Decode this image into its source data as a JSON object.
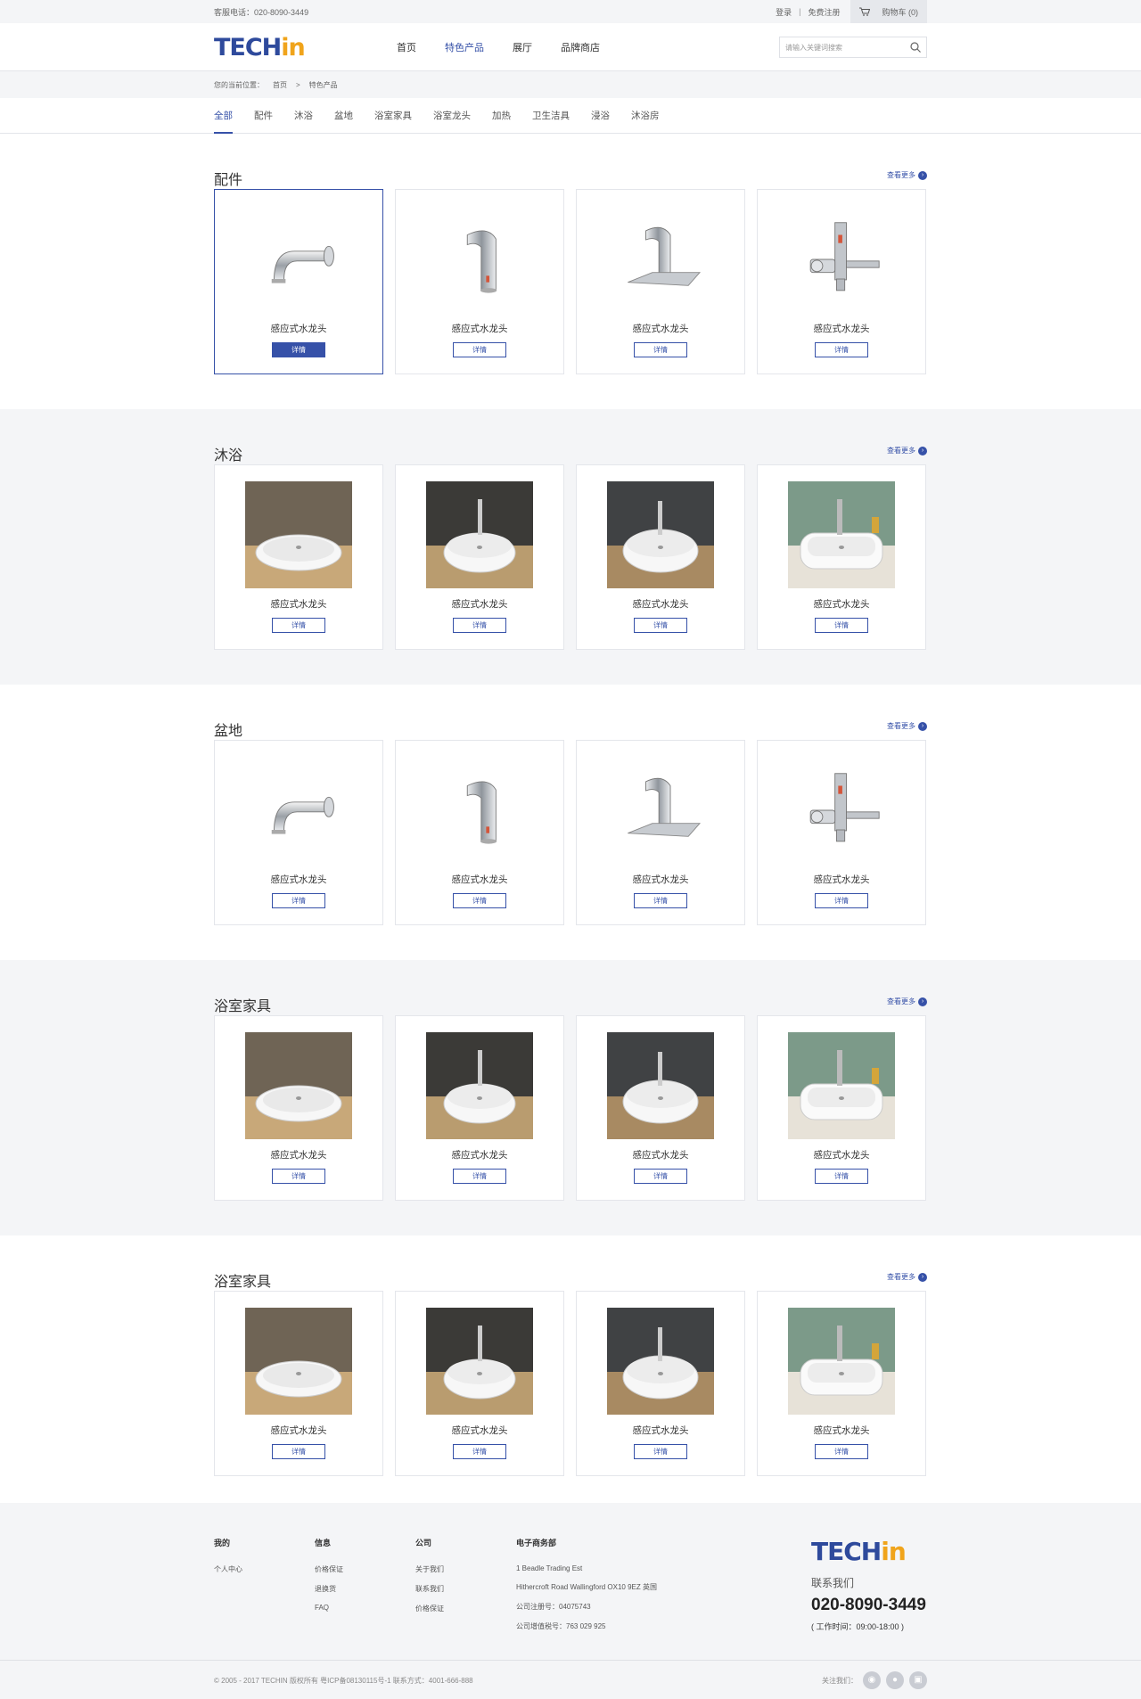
{
  "topbar": {
    "phone_label": "客服电话：",
    "phone": "020-8090-3449",
    "login": "登录",
    "sep": "|",
    "register": "免费注册",
    "cart": "购物车 (0)"
  },
  "header": {
    "logo_a": "TECH",
    "logo_b": "in",
    "nav": [
      "首页",
      "特色产品",
      "展厅",
      "品牌商店"
    ],
    "nav_active": 1,
    "search_placeholder": "请输入关键词搜索"
  },
  "breadcrumb": {
    "prefix": "您的当前位置：",
    "home": "首页",
    "sep": ">",
    "current": "特色产品"
  },
  "tabs": [
    "全部",
    "配件",
    "沐浴",
    "盆地",
    "浴室家具",
    "浴室龙头",
    "加热",
    "卫生洁具",
    "浸浴",
    "沐浴房"
  ],
  "sections": [
    {
      "title": "配件",
      "more": "查看更多",
      "kind": "faucet"
    },
    {
      "title": "沐浴",
      "more": "查看更多",
      "kind": "basin"
    },
    {
      "title": "盆地",
      "more": "查看更多",
      "kind": "faucet"
    },
    {
      "title": "浴室家具",
      "more": "查看更多",
      "kind": "basin"
    },
    {
      "title": "浴室家具",
      "more": "查看更多",
      "kind": "basin"
    }
  ],
  "product": {
    "name": "感应式水龙头",
    "button": "详情"
  },
  "footer": {
    "cols": [
      {
        "title": "我的",
        "items": [
          "个人中心"
        ]
      },
      {
        "title": "信息",
        "items": [
          "价格保证",
          "退换货",
          "FAQ"
        ]
      },
      {
        "title": "公司",
        "items": [
          "关于我们",
          "联系我们",
          "价格保证"
        ]
      },
      {
        "title": "电子商务部",
        "items": [
          "1 Beadle Trading Est",
          "Hithercroft Road Wallingford OX10 9EZ 英国",
          "公司注册号：04075743",
          "公司增值税号：763 029 925"
        ]
      }
    ],
    "contact_label": "联系我们",
    "contact_phone": "020-8090-3449",
    "hours": "( 工作时间：09:00-18:00 )",
    "copyright": "© 2005 - 2017  TECHIN 版权所有 粤ICP备08130115号-1    联系方式：4001-666-888",
    "follow": "关注我们："
  },
  "colors": {
    "brand_blue": "#3651a8",
    "brand_orange": "#f0a41b",
    "bg_gray": "#f4f5f7"
  }
}
